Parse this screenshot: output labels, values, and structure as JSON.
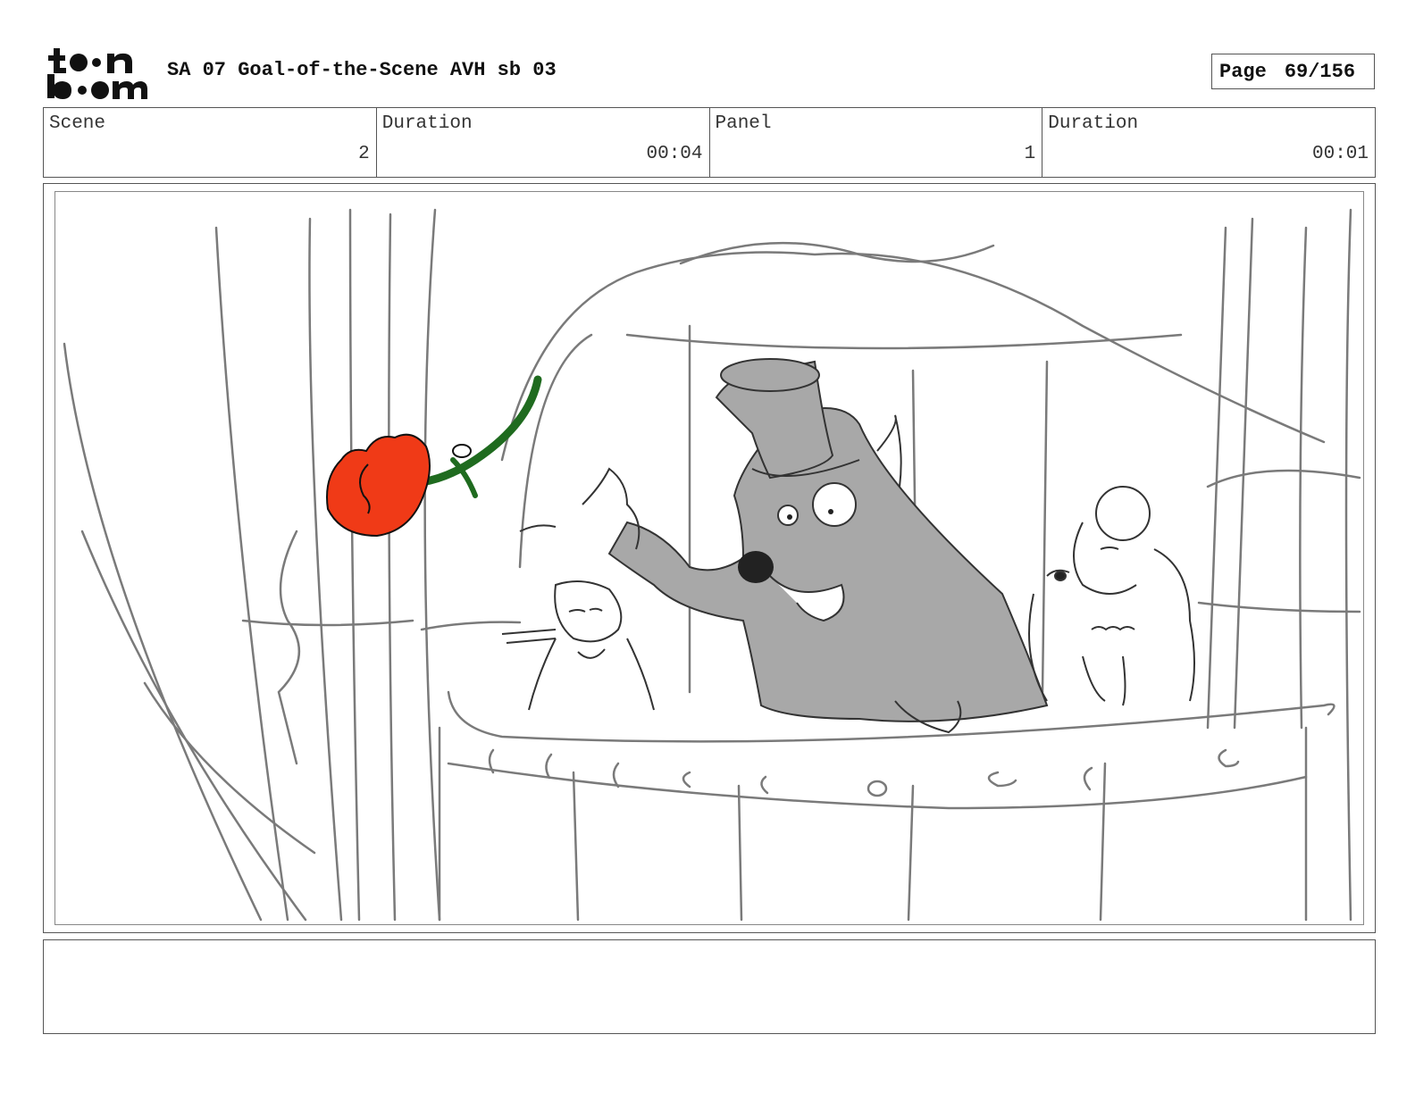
{
  "header": {
    "logo_text": "toon boom",
    "title": "SA 07 Goal-of-the-Scene AVH sb 03",
    "page_label": "Page",
    "page_number": "69/156"
  },
  "info": {
    "scene_label": "Scene",
    "scene_value": "2",
    "scene_duration_label": "Duration",
    "scene_duration_value": "00:04",
    "panel_label": "Panel",
    "panel_value": "1",
    "panel_duration_label": "Duration",
    "panel_duration_value": "00:01"
  },
  "notes": {
    "text": ""
  },
  "colors": {
    "rose": "#f03a17",
    "stem": "#1f6b1f",
    "character_fill": "#a8a8a8",
    "sketch_line": "#7a7a7a"
  }
}
